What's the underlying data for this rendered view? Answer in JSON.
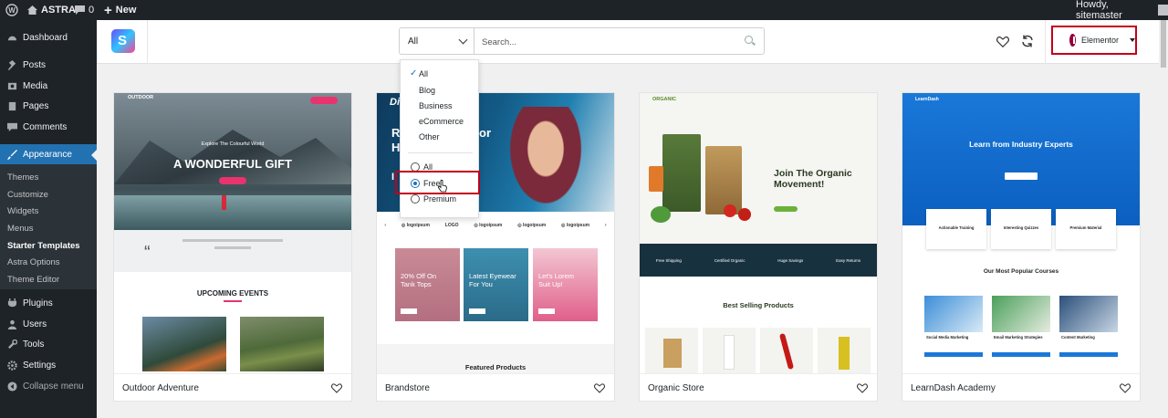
{
  "adminbar": {
    "site": "ASTRA",
    "comments": "0",
    "new_label": "New",
    "howdy": "Howdy, sitemaster"
  },
  "sidebar": {
    "items": [
      {
        "label": "Dashboard",
        "icon": "dashboard-icon"
      },
      {
        "label": "Posts",
        "icon": "pin-icon"
      },
      {
        "label": "Media",
        "icon": "media-icon"
      },
      {
        "label": "Pages",
        "icon": "pages-icon"
      },
      {
        "label": "Comments",
        "icon": "comments-icon"
      },
      {
        "label": "Appearance",
        "icon": "brush-icon"
      },
      {
        "label": "Plugins",
        "icon": "plugin-icon"
      },
      {
        "label": "Users",
        "icon": "users-icon"
      },
      {
        "label": "Tools",
        "icon": "tools-icon"
      },
      {
        "label": "Settings",
        "icon": "settings-icon"
      },
      {
        "label": "Collapse menu",
        "icon": "collapse-icon"
      }
    ],
    "submenu": [
      "Themes",
      "Customize",
      "Widgets",
      "Menus",
      "Starter Templates",
      "Astra Options",
      "Theme Editor"
    ]
  },
  "search": {
    "filter_selected": "All",
    "placeholder": "Search..."
  },
  "builder": {
    "label": "Elementor"
  },
  "dropdown": {
    "categories": [
      "All",
      "Blog",
      "Business",
      "eCommerce",
      "Other"
    ],
    "types": [
      "All",
      "Free",
      "Premium"
    ]
  },
  "cards": [
    {
      "name": "Outdoor Adventure",
      "hero": "A WONDERFUL GIFT",
      "hero_sub": "Explore The Colourful World",
      "section": "UPCOMING EVENTS",
      "brand": "OUTDOOR"
    },
    {
      "name": "Brandstore",
      "brand": "Di",
      "promo1": "20% Off On Tank Tops",
      "promo2": "Latest Eyewear For You",
      "promo3": "Let's Lorem Suit Up!",
      "section": "Featured Products"
    },
    {
      "name": "Organic Store",
      "brand": "ORGANIC",
      "hero": "Join The Organic Movement!",
      "section": "Best Selling Products",
      "features": [
        "Free Shipping",
        "Certified Organic",
        "Huge Savings",
        "Easy Returns"
      ]
    },
    {
      "name": "LearnDash Academy",
      "brand": "LearnDash",
      "hero": "Learn from Industry Experts",
      "section": "Our Most Popular Courses",
      "features": [
        "Actionable Training",
        "Interesting Quizzes",
        "Premium Material"
      ],
      "courses": [
        "Social Media Marketing",
        "Email Marketing Strategies",
        "Content Marketing"
      ]
    }
  ],
  "colors": {
    "accent": "#2271b1",
    "highlight": "#c2001a",
    "admin_dark": "#1d2327"
  }
}
